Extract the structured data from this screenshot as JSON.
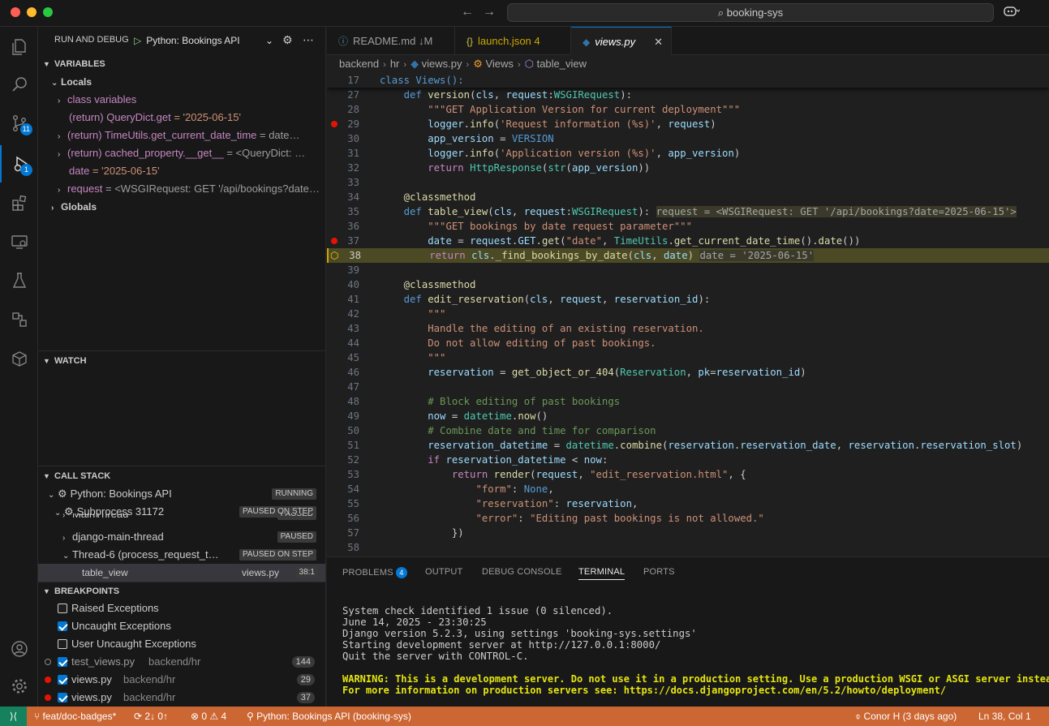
{
  "titlebar": {
    "search": "booking-sys"
  },
  "activity": {
    "scm_badge": "11",
    "debug_badge": "1"
  },
  "sidebar": {
    "title": "RUN AND DEBUG",
    "config": "Python: Bookings API",
    "variables_header": "VARIABLES",
    "locals_header": "Locals",
    "locals": [
      {
        "name": "class variables",
        "value": ""
      },
      {
        "name": "(return) QueryDict.get",
        "value": " = '2025-06-15'"
      },
      {
        "name": "(return) TimeUtils.get_current_date_time",
        "value": " = date…"
      },
      {
        "name": "(return) cached_property.__get__",
        "value": " = <QueryDict: …"
      },
      {
        "name": "date",
        "value": " = '2025-06-15'"
      },
      {
        "name": "request",
        "value": " = <WSGIRequest: GET '/api/bookings?date…"
      }
    ],
    "globals_header": "Globals",
    "watch_header": "WATCH",
    "callstack_header": "CALL STACK",
    "callstack": [
      {
        "label": "Python: Bookings API",
        "state": "RUNNING"
      },
      {
        "label": "Subprocess 31172",
        "state": "PAUSED ON STEP"
      },
      {
        "label": "MainThread",
        "state": "PAUSED"
      },
      {
        "label": "django-main-thread",
        "state": "PAUSED"
      },
      {
        "label": "Thread-6 (process_request_t…",
        "state": "PAUSED ON STEP"
      }
    ],
    "frame": {
      "name": "table_view",
      "file": "views.py",
      "pos": "38:1"
    },
    "breakpoints_header": "BREAKPOINTS",
    "breakpoints": [
      {
        "label": "Raised Exceptions",
        "path": "",
        "line": ""
      },
      {
        "label": "Uncaught Exceptions",
        "path": "",
        "line": ""
      },
      {
        "label": "User Uncaught Exceptions",
        "path": "",
        "line": ""
      },
      {
        "label": "test_views.py",
        "path": "backend/hr",
        "line": "144"
      },
      {
        "label": "views.py",
        "path": "backend/hr",
        "line": "29"
      },
      {
        "label": "views.py",
        "path": "backend/hr",
        "line": "37"
      }
    ]
  },
  "tabs": [
    {
      "label": "README.md",
      "suffix": "↓M"
    },
    {
      "label": "launch.json",
      "suffix": "4"
    },
    {
      "label": "views.py",
      "suffix": ""
    }
  ],
  "breadcrumb": [
    "backend",
    "hr",
    "views.py",
    "Views",
    "table_view"
  ],
  "editor": {
    "sticky": {
      "num": "17",
      "text": "class Views():"
    },
    "line_numbers": [
      "27",
      "28",
      "29",
      "30",
      "31",
      "32",
      "33",
      "34",
      "35",
      "36",
      "37",
      "38",
      "39",
      "40",
      "41",
      "42",
      "43",
      "44",
      "45",
      "46",
      "47",
      "48",
      "49",
      "50",
      "51",
      "52",
      "53",
      "54",
      "55",
      "56",
      "57",
      "58"
    ],
    "inline_values": {
      "line35": "request = <WSGIRequest: GET '/api/bookings?date=2025-06-15'>",
      "line38": "date = '2025-06-15'"
    }
  },
  "panel": {
    "tabs": [
      "PROBLEMS",
      "OUTPUT",
      "DEBUG CONSOLE",
      "TERMINAL",
      "PORTS"
    ],
    "problems_count": "4",
    "terminal": [
      "System check identified 1 issue (0 silenced).",
      "June 14, 2025 - 23:30:25",
      "Django version 5.2.3, using settings 'booking-sys.settings'",
      "Starting development server at http://127.0.0.1:8000/",
      "Quit the server with CONTROL-C."
    ],
    "warning": [
      "WARNING: This is a development server. Do not use it in a production setting. Use a production WSGI or ASGI server instead.",
      "For more information on production servers see: https://docs.djangoproject.com/en/5.2/howto/deployment/"
    ]
  },
  "status": {
    "branch": "feat/doc-badges*",
    "sync": "2↓ 0↑",
    "errors": "0",
    "warnings": "4",
    "debug": "Python: Bookings API (booking-sys)",
    "blame": "Conor H (3 days ago)",
    "position": "Ln 38, Col 1"
  },
  "colors": {
    "accent": "#0078d4",
    "statusbar": "#cc6633",
    "breakpoint": "#e51400"
  }
}
